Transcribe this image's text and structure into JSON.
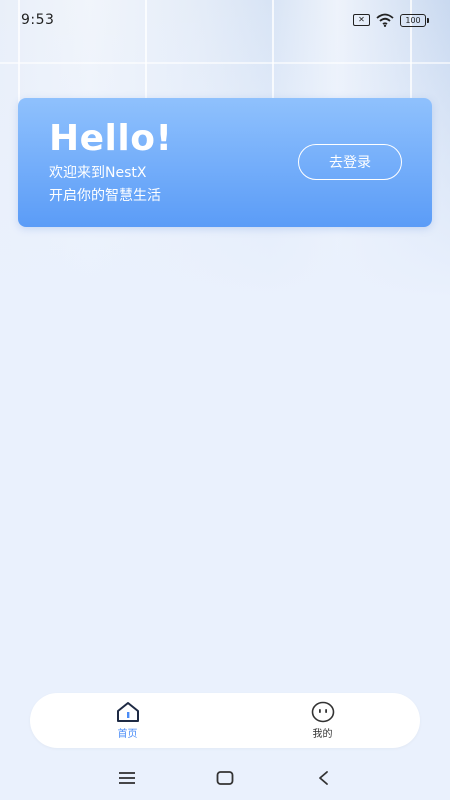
{
  "status_bar": {
    "time": "9:53",
    "sim_icon": "sim-x-icon",
    "wifi_icon": "wifi-icon",
    "battery_level": "100"
  },
  "hero": {
    "title": "Hello!",
    "line1": "欢迎来到NestX",
    "line2": "开启你的智慧生活",
    "login_label": "去登录"
  },
  "tabs": [
    {
      "label": "首页",
      "icon": "home-icon",
      "active": true
    },
    {
      "label": "我的",
      "icon": "smiley-face-icon",
      "active": false
    }
  ],
  "colors": {
    "accent": "#4a8cf7",
    "card_top": "#8fc1fd",
    "card_bottom": "#5b9cf7",
    "background": "#eaf1fd"
  },
  "nav_bar": {
    "menu_icon": "menu-icon",
    "home_icon": "square-home-icon",
    "back_icon": "back-chevron-icon"
  }
}
